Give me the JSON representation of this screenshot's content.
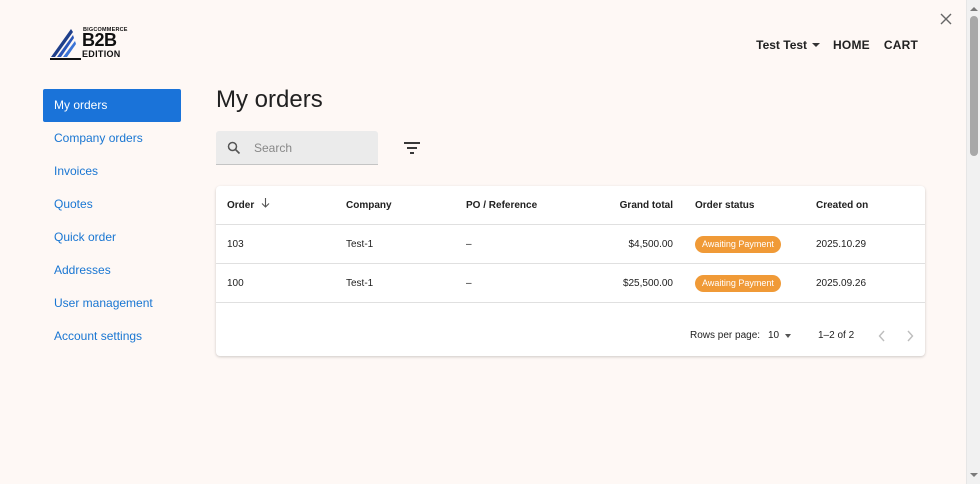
{
  "logo": {
    "top_text": "BIGCOMMERCE",
    "main_text": "B2B",
    "sub_text": "EDITION"
  },
  "header": {
    "user_name": "Test Test",
    "nav": [
      "HOME",
      "CART"
    ]
  },
  "sidebar": {
    "items": [
      {
        "label": "My orders",
        "active": true
      },
      {
        "label": "Company orders"
      },
      {
        "label": "Invoices"
      },
      {
        "label": "Quotes"
      },
      {
        "label": "Quick order"
      },
      {
        "label": "Addresses"
      },
      {
        "label": "User management"
      },
      {
        "label": "Account settings"
      }
    ]
  },
  "main": {
    "title": "My orders",
    "search": {
      "placeholder": "Search",
      "value": ""
    }
  },
  "table": {
    "columns": [
      "Order",
      "Company",
      "PO / Reference",
      "Grand total",
      "Order status",
      "Created on"
    ],
    "rows": [
      {
        "order": "103",
        "company": "Test-1",
        "po": "–",
        "total": "$4,500.00",
        "status": "Awaiting Payment",
        "created": "2025.10.29"
      },
      {
        "order": "100",
        "company": "Test-1",
        "po": "–",
        "total": "$25,500.00",
        "status": "Awaiting Payment",
        "created": "2025.09.26"
      }
    ],
    "pagination": {
      "rows_per_page_label": "Rows per page:",
      "rows_per_page": "10",
      "range": "1–2 of 2"
    }
  },
  "colors": {
    "background": "#fef8f5",
    "active_nav": "#1a73d9",
    "link": "#1976d2",
    "status_badge": "#f09a37"
  },
  "icons": [
    "close-icon",
    "search-icon",
    "filter-icon",
    "sort-arrow-down-icon",
    "chevron-left-icon",
    "chevron-right-icon",
    "dropdown-caret-icon"
  ]
}
